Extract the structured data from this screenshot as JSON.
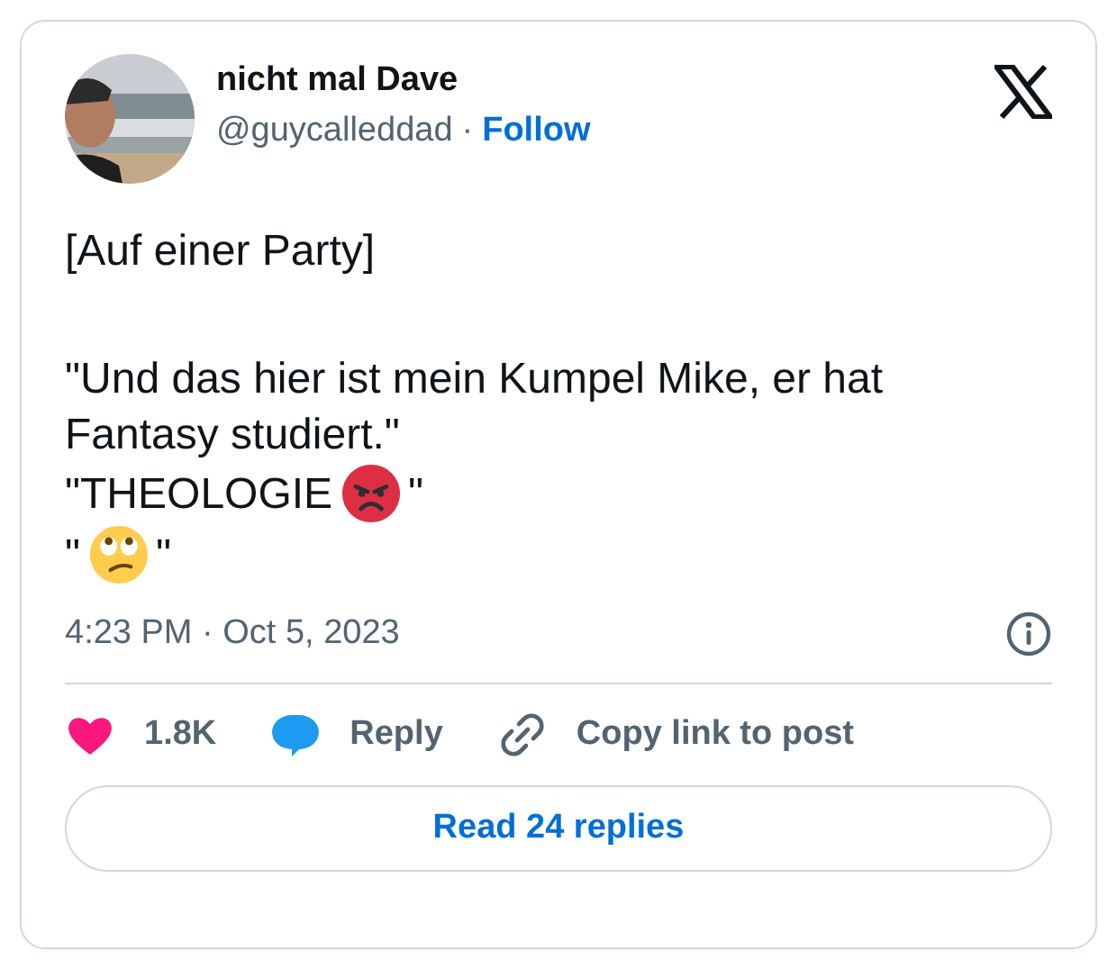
{
  "author": {
    "name": "nicht mal Dave",
    "handle": "@guycalleddad",
    "separator": "·",
    "follow": "Follow"
  },
  "body": [
    {
      "kind": "text",
      "text": "[Auf einer Party]"
    },
    {
      "kind": "gap"
    },
    {
      "kind": "text",
      "text": "\"Und das hier ist mein Kumpel Mike, er hat Fantasy studiert.\""
    },
    {
      "kind": "mixed",
      "parts": [
        {
          "kind": "text",
          "text": "\"THEOLOGIE"
        },
        {
          "kind": "angry-face"
        },
        {
          "kind": "text",
          "text": "\""
        }
      ]
    },
    {
      "kind": "mixed",
      "parts": [
        {
          "kind": "text",
          "text": "\""
        },
        {
          "kind": "eye-roll-face"
        },
        {
          "kind": "text",
          "text": "\""
        }
      ]
    }
  ],
  "timestamp": "4:23 PM · Oct 5, 2023",
  "actions": [
    {
      "kind": "like",
      "label": "1.8K"
    },
    {
      "kind": "reply",
      "label": "Reply"
    },
    {
      "kind": "link",
      "label": "Copy link to post"
    }
  ],
  "read_replies": "Read 24 replies"
}
